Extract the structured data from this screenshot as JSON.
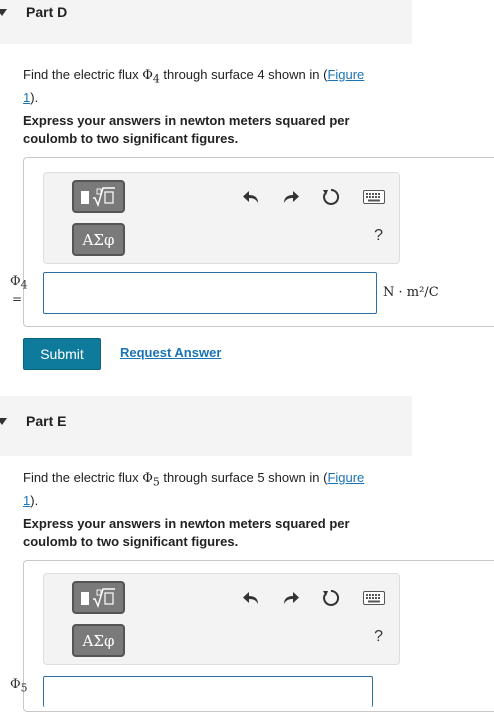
{
  "partD": {
    "title": "Part D",
    "question_prefix": "Find the electric flux ",
    "question_var": "Φ",
    "question_sub": "4",
    "question_mid": " through surface 4 shown in (",
    "figure_link_1": "Figure",
    "figure_link_2": "1",
    "question_suffix": ").",
    "instruction": "Express your answers in newton meters squared per coulomb to two significant figures.",
    "greek_label": "ΑΣφ",
    "help": "?",
    "var_symbol": "Φ",
    "var_sub": "4",
    "equals": "=",
    "input_value": "",
    "units": "N · m²/C",
    "submit_label": "Submit",
    "request_label": "Request Answer"
  },
  "partE": {
    "title": "Part E",
    "question_prefix": "Find the electric flux ",
    "question_var": "Φ",
    "question_sub": "5",
    "question_mid": " through surface 5 shown in (",
    "figure_link_1": "Figure",
    "figure_link_2": "1",
    "question_suffix": ").",
    "instruction": "Express your answers in newton meters squared per coulomb to two significant figures.",
    "greek_label": "ΑΣφ",
    "help": "?",
    "var_symbol": "Φ",
    "var_sub": "5"
  },
  "colors": {
    "accent": "#0e7a9c",
    "link": "#1a73b6",
    "input_border": "#2a6ea6"
  }
}
